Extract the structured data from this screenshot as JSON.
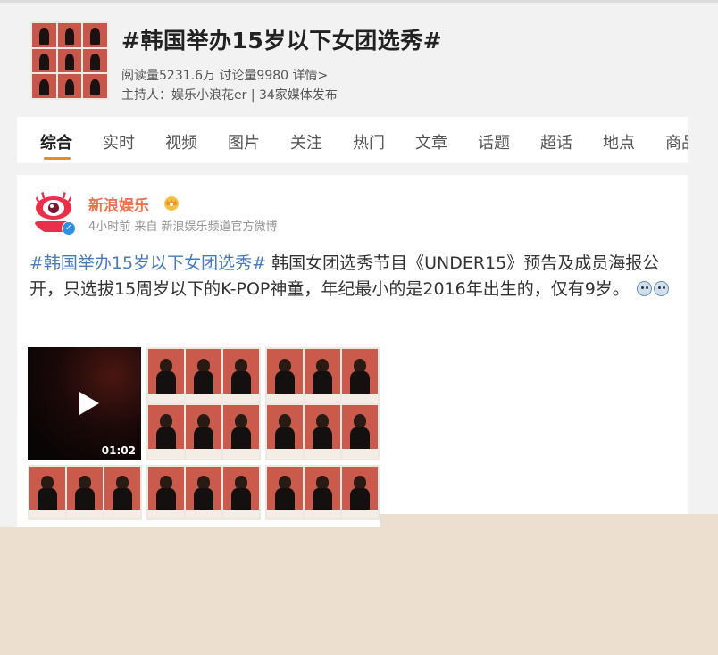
{
  "topic": {
    "title": "#韩国举办15岁以下女团选秀#",
    "stats": "阅读量5231.6万 讨论量9980 详情>",
    "host": "主持人：娱乐小浪花er | 34家媒体发布"
  },
  "tabs": [
    {
      "label": "综合",
      "active": true
    },
    {
      "label": "实时"
    },
    {
      "label": "视频"
    },
    {
      "label": "图片"
    },
    {
      "label": "关注"
    },
    {
      "label": "热门"
    },
    {
      "label": "文章"
    },
    {
      "label": "话题"
    },
    {
      "label": "超话"
    },
    {
      "label": "地点"
    },
    {
      "label": "商品"
    }
  ],
  "post": {
    "author": "新浪娱乐",
    "meta": "4小时前 来自 新浪娱乐频道官方微博",
    "hashtag": "#韩国举办15岁以下女团选秀#",
    "body": " 韩国女团选秀节目《UNDER15》预告及成员海报公开，只选拔15周岁以下的K-POP神童，年纪最小的是2016年出生的，仅有9岁。",
    "video_duration": "01:02"
  },
  "colors": {
    "accent": "#f08a24",
    "author": "#eb7350",
    "link": "#4b7ab8",
    "verified": "#2f8fe0",
    "overlay": "#eddfd0"
  },
  "icons": [
    "play-icon",
    "verified-icon",
    "crown-icon",
    "emoji-icon"
  ]
}
